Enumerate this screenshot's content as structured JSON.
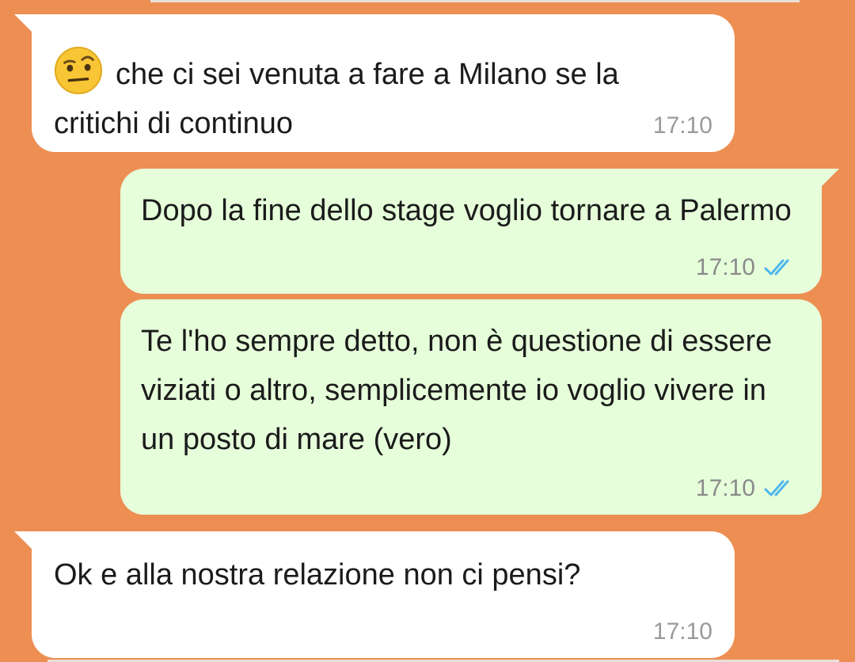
{
  "chat": {
    "background_color": "#ED8E52",
    "incoming_bubble_color": "#FFFFFF",
    "outgoing_bubble_color": "#E6FFDA",
    "read_tick_color": "#4FB6EC",
    "messages": [
      {
        "direction": "incoming",
        "emoji": "face-with-raised-eyebrow",
        "text": "che ci sei venuta a fare a Milano se la critichi di continuo",
        "time": "17:10"
      },
      {
        "direction": "outgoing",
        "text": "Dopo la fine dello stage voglio tornare a Palermo",
        "time": "17:10",
        "status": "read-double-check"
      },
      {
        "direction": "outgoing",
        "text": "Te l'ho sempre detto, non è questione di essere viziati o altro, semplicemente io voglio vivere in un posto di mare (vero)",
        "time": "17:10",
        "status": "read-double-check"
      },
      {
        "direction": "incoming",
        "text": "Ok e alla nostra relazione non ci pensi?",
        "time": "17:10"
      }
    ]
  }
}
